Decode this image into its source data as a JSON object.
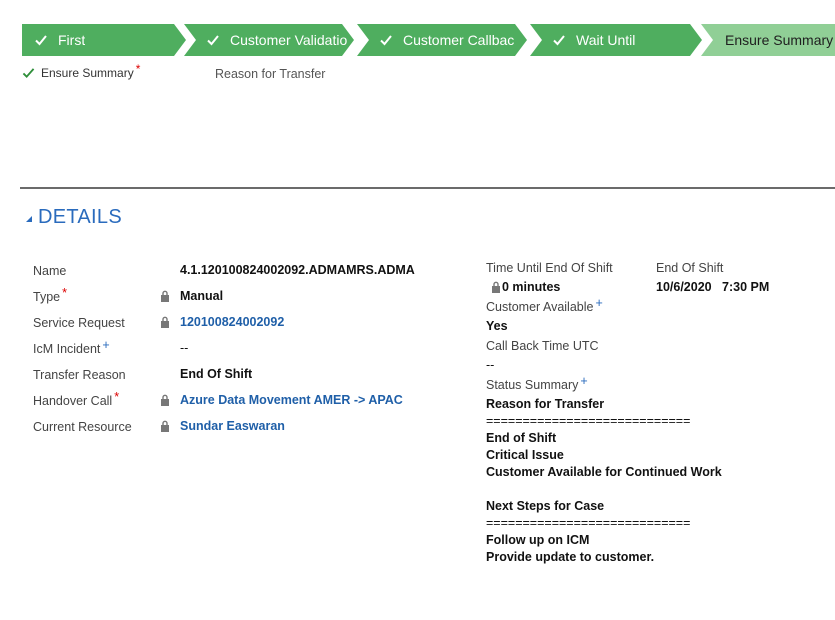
{
  "process": {
    "stages": [
      {
        "label": "First",
        "state": "completed"
      },
      {
        "label": "Customer Validatio",
        "state": "completed"
      },
      {
        "label": "Customer Callbac",
        "state": "completed"
      },
      {
        "label": "Wait Until",
        "state": "completed"
      },
      {
        "label": "Ensure Summary",
        "state": "active"
      }
    ],
    "substep_label": "Ensure Summary",
    "substep_required_mark": "*",
    "tab_label": "Reason for Transfer"
  },
  "details": {
    "section_title": "DETAILS",
    "fields": [
      {
        "label": "Name",
        "value": "4.1.120100824002092.ADMAMRS.ADMA",
        "mark": "",
        "locked": false,
        "link": false
      },
      {
        "label": "Type",
        "value": "Manual",
        "mark": "*",
        "locked": true,
        "link": false
      },
      {
        "label": "Service Request",
        "value": "120100824002092",
        "mark": "",
        "locked": true,
        "link": true
      },
      {
        "label": "IcM Incident",
        "value": "--",
        "mark": "+",
        "locked": false,
        "link": false
      },
      {
        "label": "Transfer Reason",
        "value": "End Of Shift",
        "mark": "",
        "locked": false,
        "link": false
      },
      {
        "label": "Handover Call",
        "value": "Azure Data Movement AMER -> APAC",
        "mark": "*",
        "locked": true,
        "link": true
      },
      {
        "label": "Current Resource",
        "value": "Sundar Easwaran",
        "mark": "",
        "locked": true,
        "link": true
      }
    ],
    "right": {
      "time_until_label": "Time Until End Of Shift",
      "time_until_value": "0 minutes",
      "end_of_shift_label": "End Of Shift",
      "end_of_shift_value": "10/6/2020   7:30 PM",
      "customer_available_label": "Customer Available",
      "customer_available_mark": "+",
      "customer_available_value": "Yes",
      "callback_label": "Call Back Time UTC",
      "callback_value": "--",
      "status_summary_label": "Status Summary",
      "status_summary_mark": "+",
      "status_summary_lines": [
        "Reason for Transfer",
        "============================",
        "End of Shift",
        "Critical Issue",
        "Customer Available for Continued Work",
        "",
        "Next Steps for Case",
        "============================",
        "Follow up on ICM",
        "Provide update to customer."
      ]
    }
  },
  "colors": {
    "completed": "#4fae5f",
    "active": "#90cf96",
    "accent": "#2a6bbd",
    "required": "#dd0000"
  }
}
